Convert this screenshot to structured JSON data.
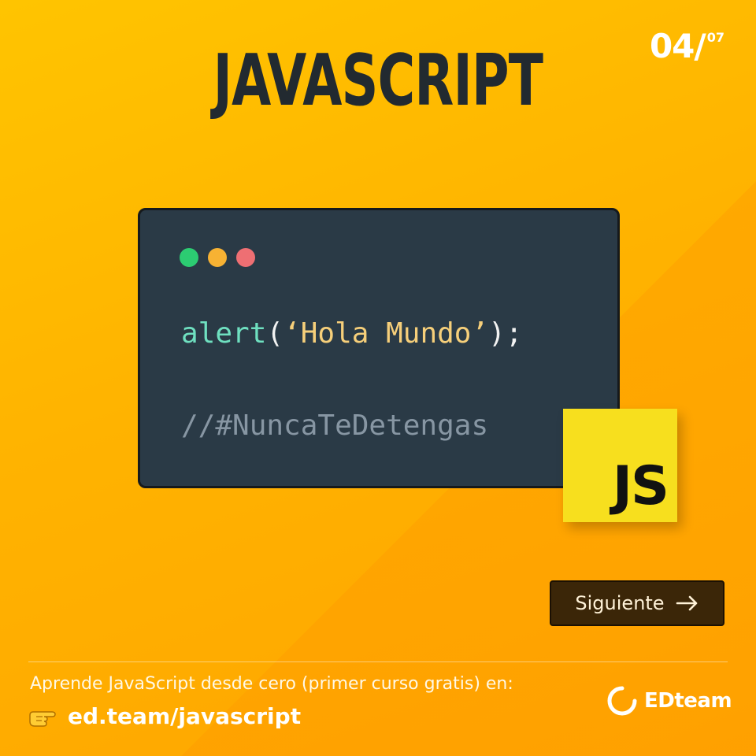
{
  "counter": {
    "current": "04/",
    "total": "07"
  },
  "title": "JAVASCRIPT",
  "code": {
    "window_dots": [
      "green",
      "yellow",
      "red"
    ],
    "line1": {
      "fn": "alert",
      "open": "(",
      "string": "‘Hola Mundo’",
      "close": ");"
    },
    "line2": "//#NuncaTeDetengas"
  },
  "badge": {
    "label": "JS",
    "icon": "js-logo-icon"
  },
  "next_button": {
    "label": "Siguiente",
    "icon": "arrow-right-icon"
  },
  "footer": {
    "text": "Aprende JavaScript desde cero (primer curso gratis) en:",
    "link": "ed.team/javascript",
    "pointer_icon": "pointing-hand-icon"
  },
  "brand": {
    "name": "EDteam",
    "icon": "edteam-logo-icon"
  },
  "colors": {
    "background": "#ffb300",
    "title": "#222a30",
    "code_bg": "#2a3a46",
    "js_yellow": "#f7df1e",
    "button_bg": "#3b2608"
  }
}
